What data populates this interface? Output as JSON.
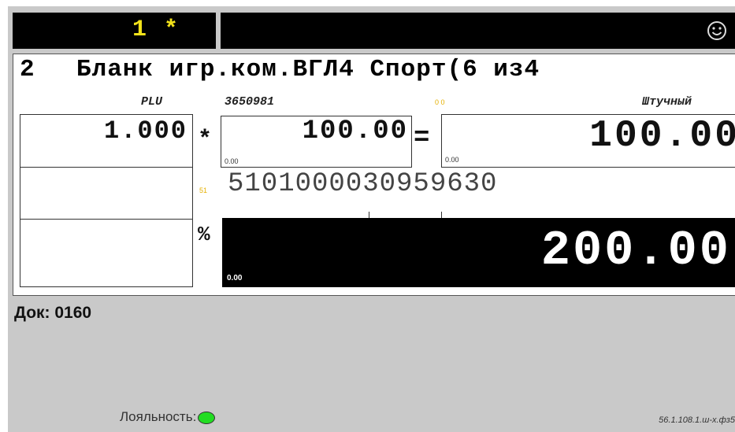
{
  "header": {
    "register_number": "1 *",
    "smiley_icon": "smile-icon"
  },
  "item": {
    "index": "2",
    "title": "Бланк игр.ком.ВГЛ4 Спорт(6 из4",
    "plu_label": "PLU",
    "plu_code": "3650981",
    "mode_label": "Штучный",
    "indicator": "0 0",
    "quantity": "1.000",
    "multiply_sign": "*",
    "price": "100.00",
    "price_small": "0.00",
    "equals_sign": "=",
    "sum": "100.00",
    "sum_small": "0.00",
    "barcode_tag": "51",
    "barcode": "5101000030959630",
    "percent_sign": "%",
    "total": "200.00",
    "total_small": "0.00"
  },
  "footer": {
    "doc_label": "Док: 0160",
    "loyalty_label": "Лояльность:",
    "loyalty_status_color": "#22dd22",
    "version": "56.1.108.1.ш-х.фз5"
  }
}
